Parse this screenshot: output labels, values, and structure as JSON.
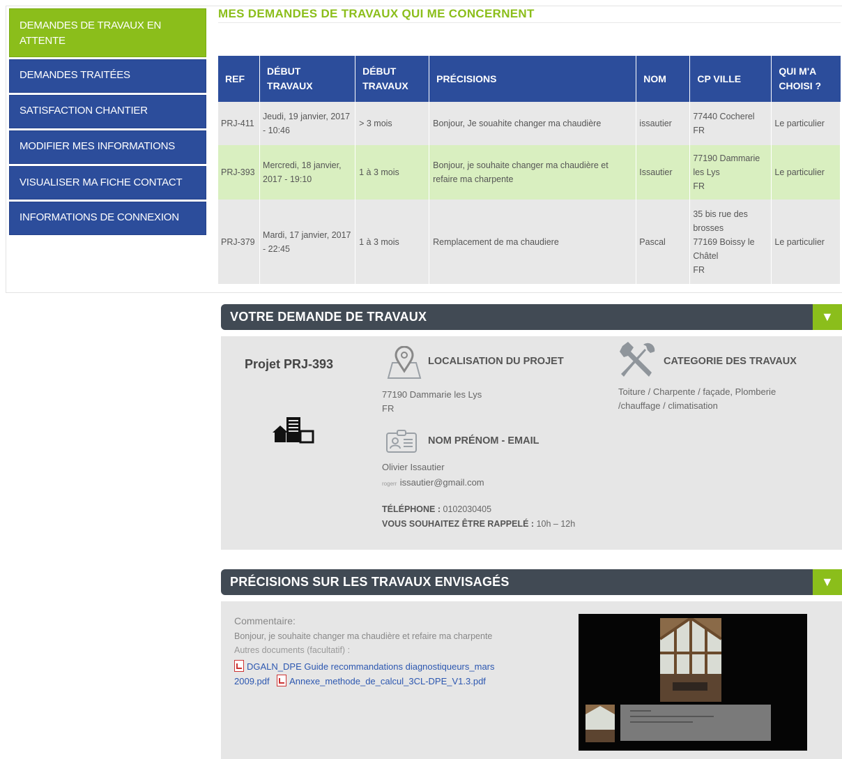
{
  "sidebar": {
    "items": [
      {
        "label": "DEMANDES DE TRAVAUX EN ATTENTE",
        "active": true
      },
      {
        "label": "DEMANDES TRAITÉES",
        "active": false
      },
      {
        "label": "SATISFACTION CHANTIER",
        "active": false
      },
      {
        "label": "MODIFIER MES INFORMATIONS",
        "active": false
      },
      {
        "label": "VISUALISER MA FICHE CONTACT",
        "active": false
      },
      {
        "label": "INFORMATIONS DE CONNEXION",
        "active": false
      }
    ]
  },
  "page": {
    "title": "MES DEMANDES DE TRAVAUX QUI ME CONCERNENT"
  },
  "table": {
    "headers": [
      "REF",
      "DÉBUT TRAVAUX",
      "DÉBUT TRAVAUX",
      "PRÉCISIONS",
      "NOM",
      "CP VILLE",
      "QUI M'A CHOISI ?"
    ],
    "rows": [
      {
        "ref": "PRJ-411",
        "date": "Jeudi, 19 janvier, 2017 - 10:46",
        "delai": "> 3 mois",
        "precisions": "Bonjour, Je souahite changer ma chaudière",
        "nom": "issautier",
        "ville": "77440 Cocherel\nFR",
        "choix": "Le particulier"
      },
      {
        "ref": "PRJ-393",
        "date": "Mercredi, 18 janvier, 2017 - 19:10",
        "delai": "1 à 3 mois",
        "precisions": "Bonjour, je souhaite changer ma chaudière et refaire ma charpente",
        "nom": "Issautier",
        "ville": "77190 Dammarie les Lys\nFR",
        "choix": "Le particulier"
      },
      {
        "ref": "PRJ-379",
        "date": "Mardi, 17 janvier, 2017 - 22:45",
        "delai": "1 à 3 mois",
        "precisions": "Remplacement de ma chaudiere",
        "nom": "Pascal",
        "ville": "35 bis rue des brosses\n77169 Boissy le Châtel\nFR",
        "choix": "Le particulier"
      }
    ]
  },
  "demande": {
    "header": "VOTRE DEMANDE DE TRAVAUX",
    "toggle": "▼",
    "projet": "Projet PRJ-393",
    "localisation_label": "LOCALISATION DU PROJET",
    "localisation_value": "77190 Dammarie les Lys\nFR",
    "nom_label": "NOM PRÉNOM - EMAIL",
    "nom_value": "Olivier Issautier",
    "email_prefix": "rogerr",
    "email_value": "issautier@gmail.com",
    "tel_label": "TÉLÉPHONE :",
    "tel_value": "0102030405",
    "rappel_label": "VOUS SOUHAITEZ ÊTRE RAPPELÉ :",
    "rappel_value": "10h – 12h",
    "categorie_label": "CATEGORIE DES TRAVAUX",
    "categorie_value": "Toiture / Charpente / façade, Plomberie /chauffage / climatisation"
  },
  "precisions": {
    "header": "PRÉCISIONS SUR LES TRAVAUX ENVISAGÉS",
    "toggle": "▼",
    "commentaire_label": "Commentaire:",
    "commentaire_value": "Bonjour, je souhaite changer ma chaudière et refaire ma charpente",
    "docs_label": "Autres documents (facultatif) :",
    "doc1": "DGALN_DPE Guide recommandations diagnostiqueurs_mars 2009.pdf",
    "doc2": "Annexe_methode_de_calcul_3CL-DPE_V1.3.pdf"
  },
  "colors": {
    "primary_blue": "#2c4d9b",
    "accent_green": "#8bbe1b",
    "panel_dark": "#414a54"
  }
}
